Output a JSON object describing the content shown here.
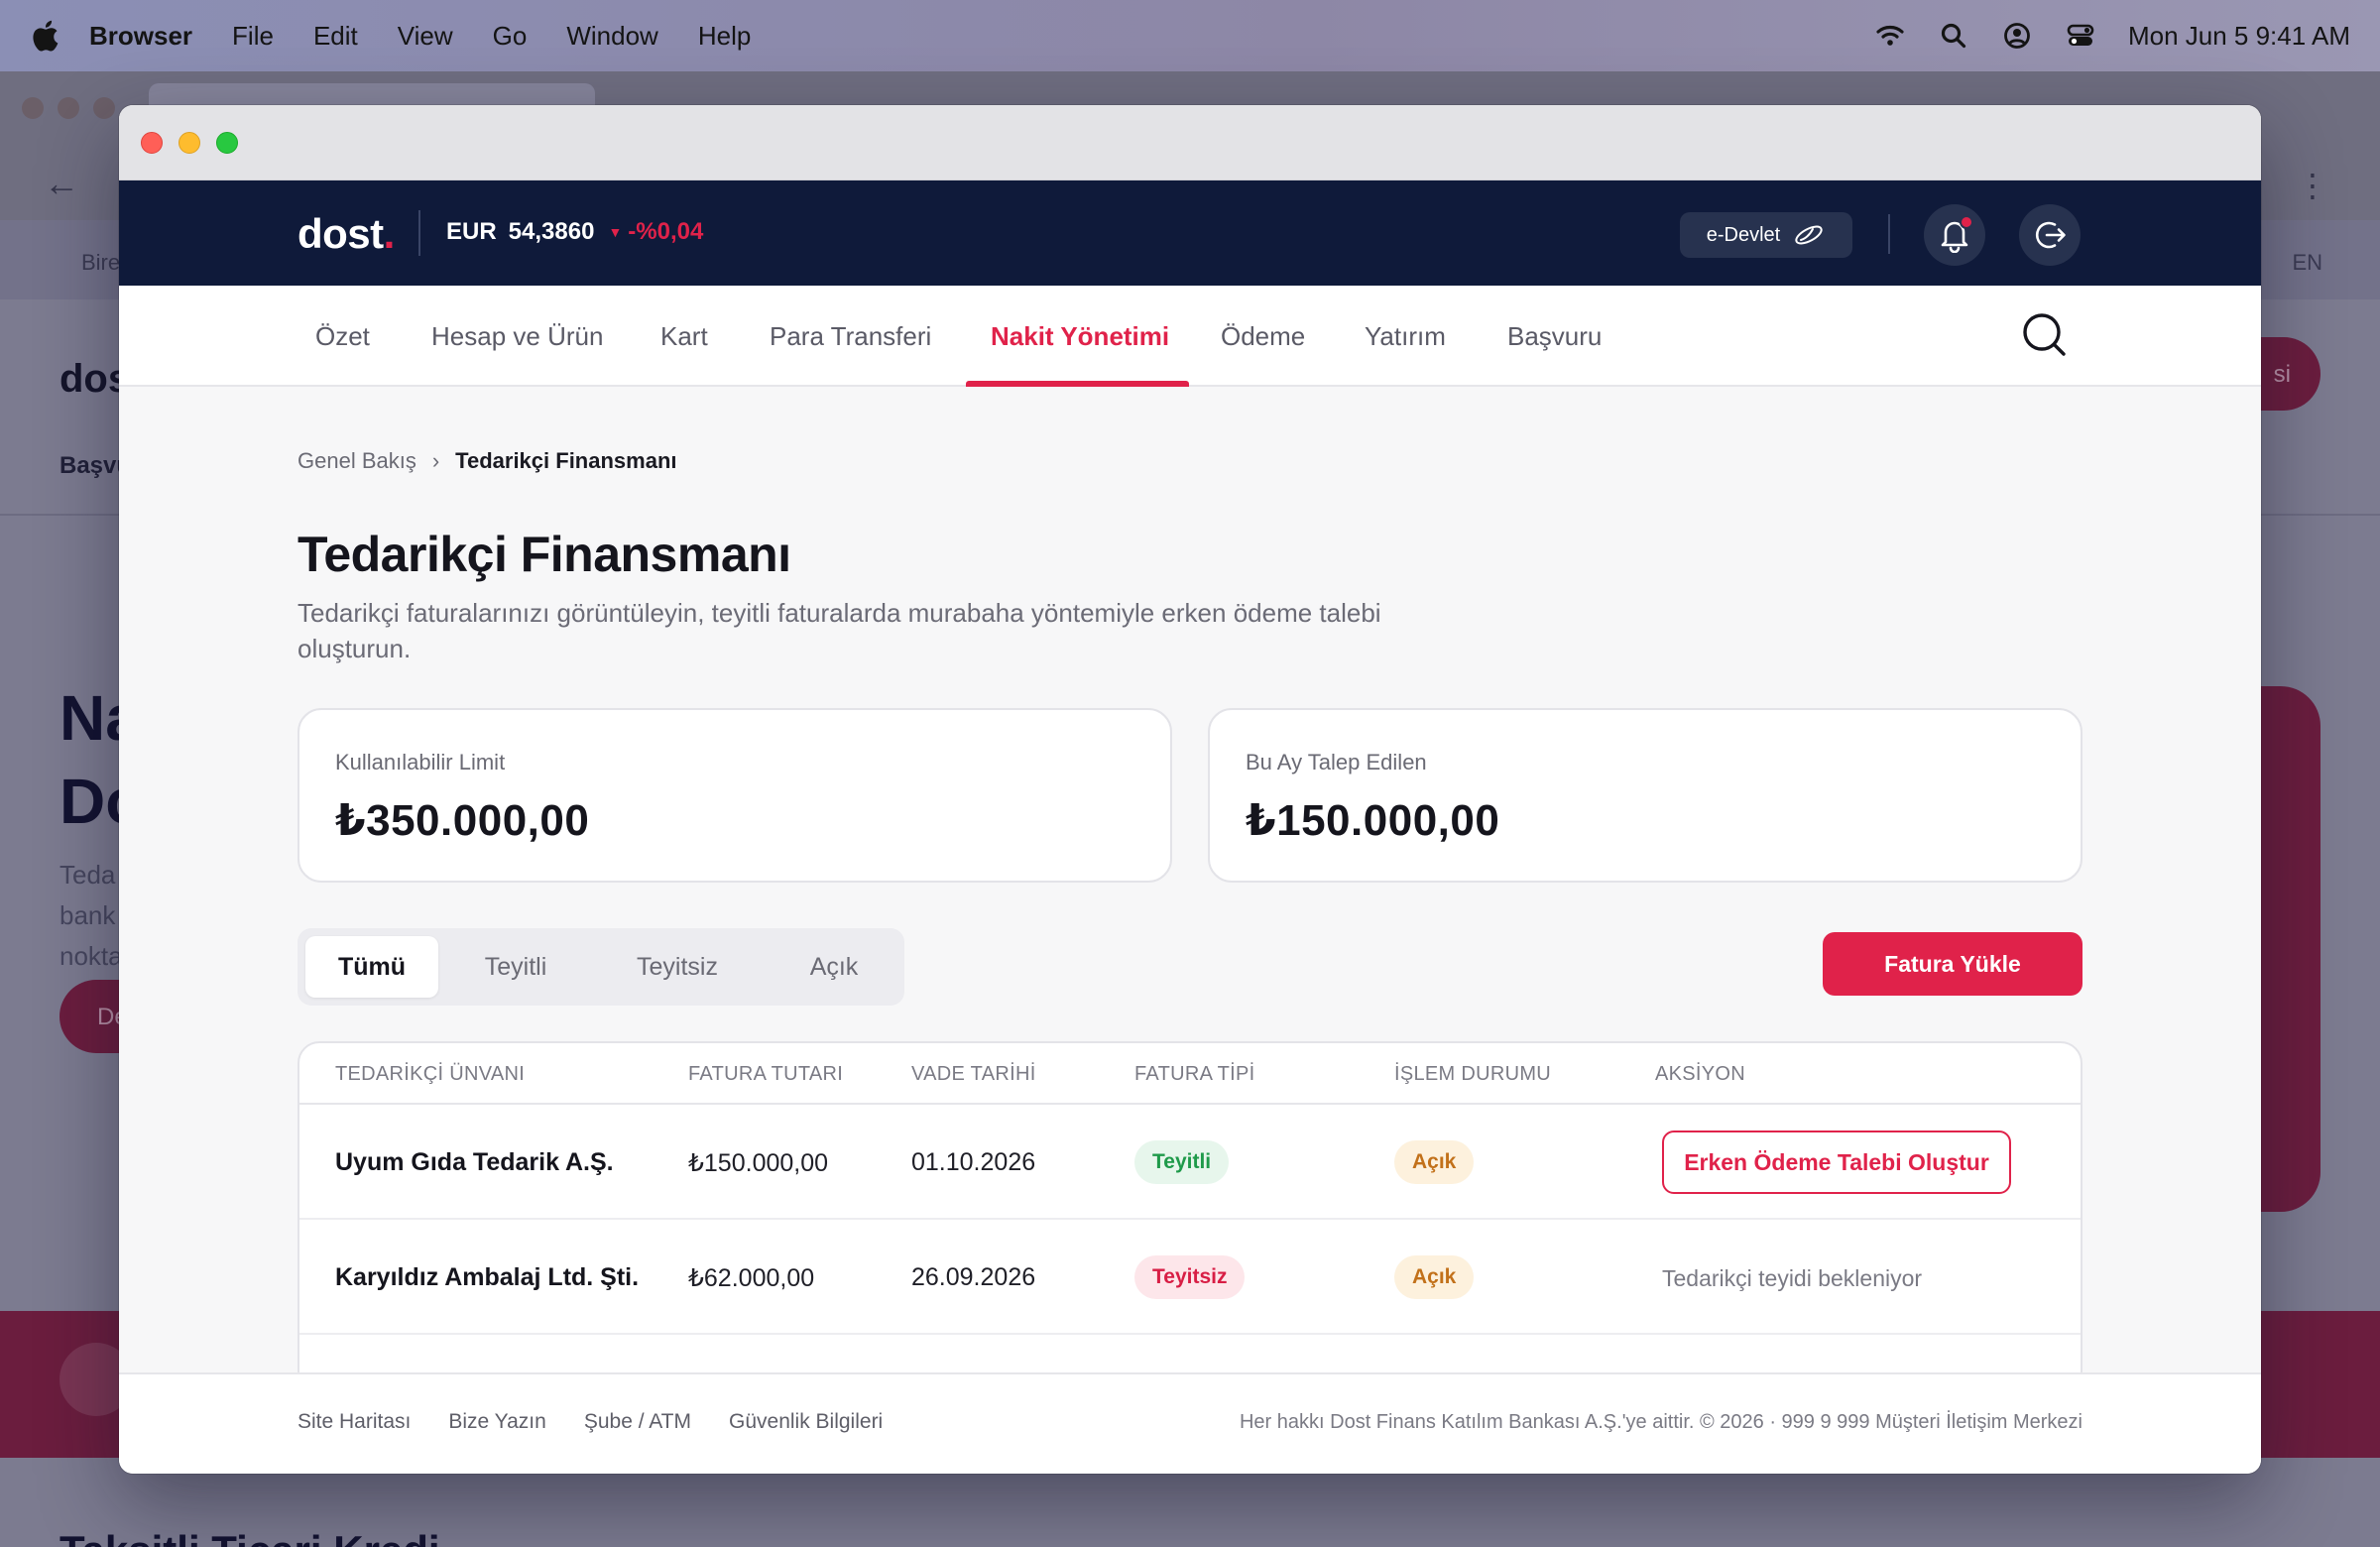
{
  "menubar": {
    "app_name": "Browser",
    "items": [
      "File",
      "Edit",
      "View",
      "Go",
      "Window",
      "Help"
    ],
    "clock": "Mon Jun 5  9:41 AM",
    "icons": [
      "wifi-icon",
      "search-icon",
      "user-icon",
      "control-center-icon"
    ]
  },
  "background": {
    "strip_left": "Bire",
    "strip_right": "EN",
    "logo": "dos",
    "nav": "Başvu",
    "hero_line1": "Na",
    "hero_line2": "Do",
    "hero_sub1": "Teda",
    "hero_sub2": "bank",
    "hero_sub3": "nokta",
    "hero_button": "De",
    "right_pill": "si",
    "bottom_title": "Taksitli Ticari Kredi"
  },
  "header": {
    "brand": "dost",
    "brand_dot": ".",
    "fx_currency": "EUR",
    "fx_rate": "54,3860",
    "fx_change": "-%0,04",
    "edevlet_label": "e-Devlet",
    "colors": {
      "navy": "#0f1a3a",
      "accent": "#e0224a"
    }
  },
  "nav": {
    "items": [
      "Özet",
      "Hesap ve Ürün",
      "Kart",
      "Para Transferi",
      "Nakit Yönetimi",
      "Ödeme",
      "Yatırım",
      "Başvuru"
    ],
    "active": "Nakit Yönetimi"
  },
  "breadcrumb": {
    "parent": "Genel Bakış",
    "separator": "›",
    "current": "Tedarikçi Finansmanı"
  },
  "page": {
    "title": "Tedarikçi Finansmanı",
    "subtitle": "Tedarikçi faturalarınızı görüntüleyin, teyitli faturalarda murabaha yöntemiyle erken ödeme talebi oluşturun."
  },
  "stats": [
    {
      "label": "Kullanılabilir Limit",
      "value": "₺350.000,00"
    },
    {
      "label": "Bu Ay Talep Edilen",
      "value": "₺150.000,00"
    }
  ],
  "filters": {
    "tabs": [
      "Tümü",
      "Teyitli",
      "Teyitsiz",
      "Açık"
    ],
    "active": "Tümü"
  },
  "upload_button": "Fatura Yükle",
  "table": {
    "headers": [
      "TEDARİKÇİ ÜNVANI",
      "FATURA TUTARI",
      "VADE TARİHİ",
      "FATURA TİPİ",
      "İŞLEM DURUMU",
      "AKSİYON"
    ],
    "rows": [
      {
        "supplier": "Uyum Gıda Tedarik A.Ş.",
        "amount": "₺150.000,00",
        "due": "01.10.2026",
        "type": "Teyitli",
        "status": "Açık",
        "action": "Erken Ödeme Talebi Oluştur"
      },
      {
        "supplier": "Karyıldız Ambalaj Ltd. Şti.",
        "amount": "₺62.000,00",
        "due": "26.09.2026",
        "type": "Teyitsiz",
        "status": "Açık",
        "action": "Tedarikçi teyidi bekleniyor"
      }
    ]
  },
  "footer": {
    "links": [
      "Site Haritası",
      "Bize Yazın",
      "Şube / ATM",
      "Güvenlik Bilgileri"
    ],
    "copyright": "Her hakkı Dost Finans Katılım Bankası A.Ş.'ye aittir. © 2026 · 999 9 999 Müşteri İletişim Merkezi"
  }
}
